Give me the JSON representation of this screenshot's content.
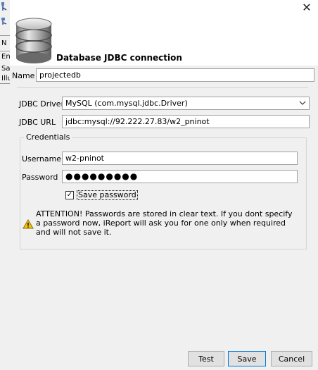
{
  "dialog": {
    "title": "Database JDBC connection",
    "close_glyph": "✕"
  },
  "form": {
    "name_label": "Name",
    "name_value": "projectedb",
    "driver_label": "JDBC Driver",
    "driver_value": "MySQL (com.mysql.jdbc.Driver)",
    "url_label": "JDBC URL",
    "url_value": "jdbc:mysql://92.222.27.83/w2_pninot"
  },
  "credentials": {
    "legend": "Credentials",
    "username_label": "Username",
    "username_value": "w2-pninot",
    "password_label": "Password",
    "password_masked": "●●●●●●●●●",
    "save_password_label": "Save password",
    "save_password_checked": "✓",
    "warning_text": "ATTENTION! Passwords are stored in clear text. If you dont specify a password now, iReport will ask you for one only when required and will not save it."
  },
  "buttons": {
    "test": "Test",
    "save": "Save",
    "cancel": "Cancel"
  },
  "background_window": {
    "row1": "N",
    "row2": "En",
    "row3": "Sa",
    "row4": "Illu"
  },
  "icons": {
    "database": "database-icon",
    "warning": "warning-icon",
    "dropdown": "chevron-down-icon",
    "close": "close-icon"
  },
  "colors": {
    "default_button_border": "#0078d7",
    "warning_fill": "#f4c20d"
  }
}
